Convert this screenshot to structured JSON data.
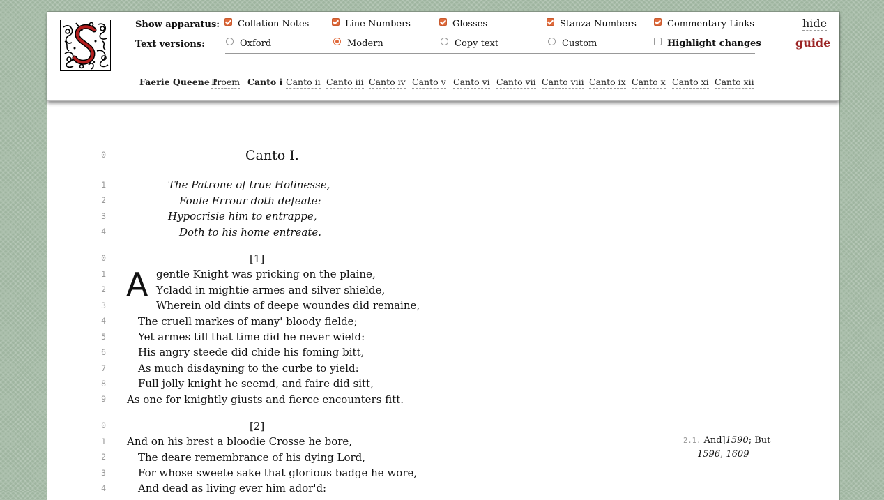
{
  "apparatus": {
    "label": "Show apparatus:",
    "options": [
      {
        "label": "Collation Notes",
        "checked": true
      },
      {
        "label": "Line Numbers",
        "checked": true
      },
      {
        "label": "Glosses",
        "checked": true
      },
      {
        "label": "Stanza Numbers",
        "checked": true
      },
      {
        "label": "Commentary Links",
        "checked": true
      }
    ]
  },
  "versions": {
    "label": "Text versions:",
    "options": [
      {
        "label": "Oxford",
        "selected": false
      },
      {
        "label": "Modern",
        "selected": true
      },
      {
        "label": "Copy text",
        "selected": false
      },
      {
        "label": "Custom",
        "selected": false
      }
    ],
    "highlight": {
      "label": "Highlight changes",
      "checked": false
    }
  },
  "links": {
    "hide": "hide",
    "guide": "guide"
  },
  "nav": {
    "book": "Faerie Queene I",
    "items": [
      "Proem",
      "Canto i",
      "Canto ii",
      "Canto iii",
      "Canto iv",
      "Canto v",
      "Canto vi",
      "Canto vii",
      "Canto viii",
      "Canto ix",
      "Canto x",
      "Canto xi",
      "Canto xii"
    ],
    "current": "Canto i"
  },
  "canto": {
    "title_num": "0",
    "title": "Canto I.",
    "argument": [
      {
        "n": "1",
        "text": "The Patrone of true Holinesse,"
      },
      {
        "n": "2",
        "text": "Foule Errour doth defeate:"
      },
      {
        "n": "3",
        "text": "Hypocrisie him to entrappe,"
      },
      {
        "n": "4",
        "text": "Doth to his home entreate."
      }
    ],
    "stanza1": {
      "num_line": "0",
      "label": "[1]",
      "dropcap": "A",
      "lines": [
        {
          "n": "1",
          "text": "gentle Knight was pricking on the plaine,"
        },
        {
          "n": "2",
          "text": "Ycladd in mightie armes and silver shielde,"
        },
        {
          "n": "3",
          "text": "Wherein old dints of deepe woundes did remaine,"
        },
        {
          "n": "4",
          "text": "The cruell markes of many' bloody fielde;"
        },
        {
          "n": "5",
          "text": "Yet armes till that time did he never wield:"
        },
        {
          "n": "6",
          "text": "His angry steede did chide his foming bitt,"
        },
        {
          "n": "7",
          "text": "As much disdayning to the curbe to yield:"
        },
        {
          "n": "8",
          "text": "Full jolly knight he seemd, and faire did sitt,"
        },
        {
          "n": "9",
          "text": "As one for knightly giusts and fierce encounters fitt."
        }
      ]
    },
    "stanza2": {
      "num_line": "0",
      "label": "[2]",
      "lines": [
        {
          "n": "1",
          "text": "And on his brest a bloodie Crosse he bore,"
        },
        {
          "n": "2",
          "text": "The deare remembrance of his dying Lord,"
        },
        {
          "n": "3",
          "text": "For whose sweete sake that glorious badge he wore,"
        },
        {
          "n": "4",
          "text": "And dead as living ever him ador'd:"
        }
      ]
    }
  },
  "collation_note": {
    "ref": "2.1.",
    "lemma": "And]",
    "w1": "1590",
    "sep": ";",
    "reading": "But",
    "w2": "1596",
    "comma": ",",
    "w3": "1609"
  }
}
